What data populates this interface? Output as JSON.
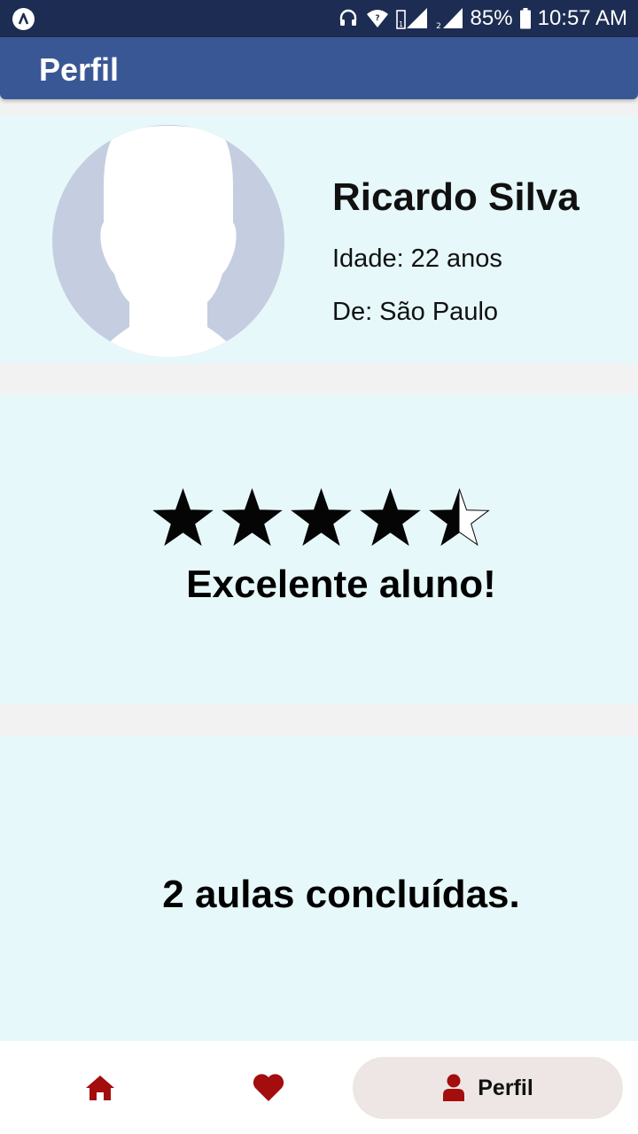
{
  "status_bar": {
    "battery": "85%",
    "time": "10:57 AM",
    "icons": [
      "app-logo-icon",
      "headset-icon",
      "wifi-icon",
      "signal-icon",
      "signal-icon",
      "battery-icon"
    ]
  },
  "app_bar": {
    "title": "Perfil"
  },
  "profile": {
    "name": "Ricardo Silva",
    "age": "Idade: 22 anos",
    "city": "De: São Paulo"
  },
  "rating": {
    "stars": 4.5,
    "max_stars": 5,
    "text": "Excelente aluno!"
  },
  "lessons": {
    "text": "2 aulas concluídas."
  },
  "bottom_nav": {
    "items": [
      {
        "icon": "home-icon",
        "label": "",
        "active": false
      },
      {
        "icon": "heart-icon",
        "label": "",
        "active": false
      },
      {
        "icon": "user-icon",
        "label": "Perfil",
        "active": true
      }
    ]
  },
  "colors": {
    "status_bar": "#1d2c52",
    "app_bar": "#3a5795",
    "card_bg": "#e6f8f9",
    "nav_icon": "#a30d0d",
    "active_pill": "#ede6e4"
  }
}
